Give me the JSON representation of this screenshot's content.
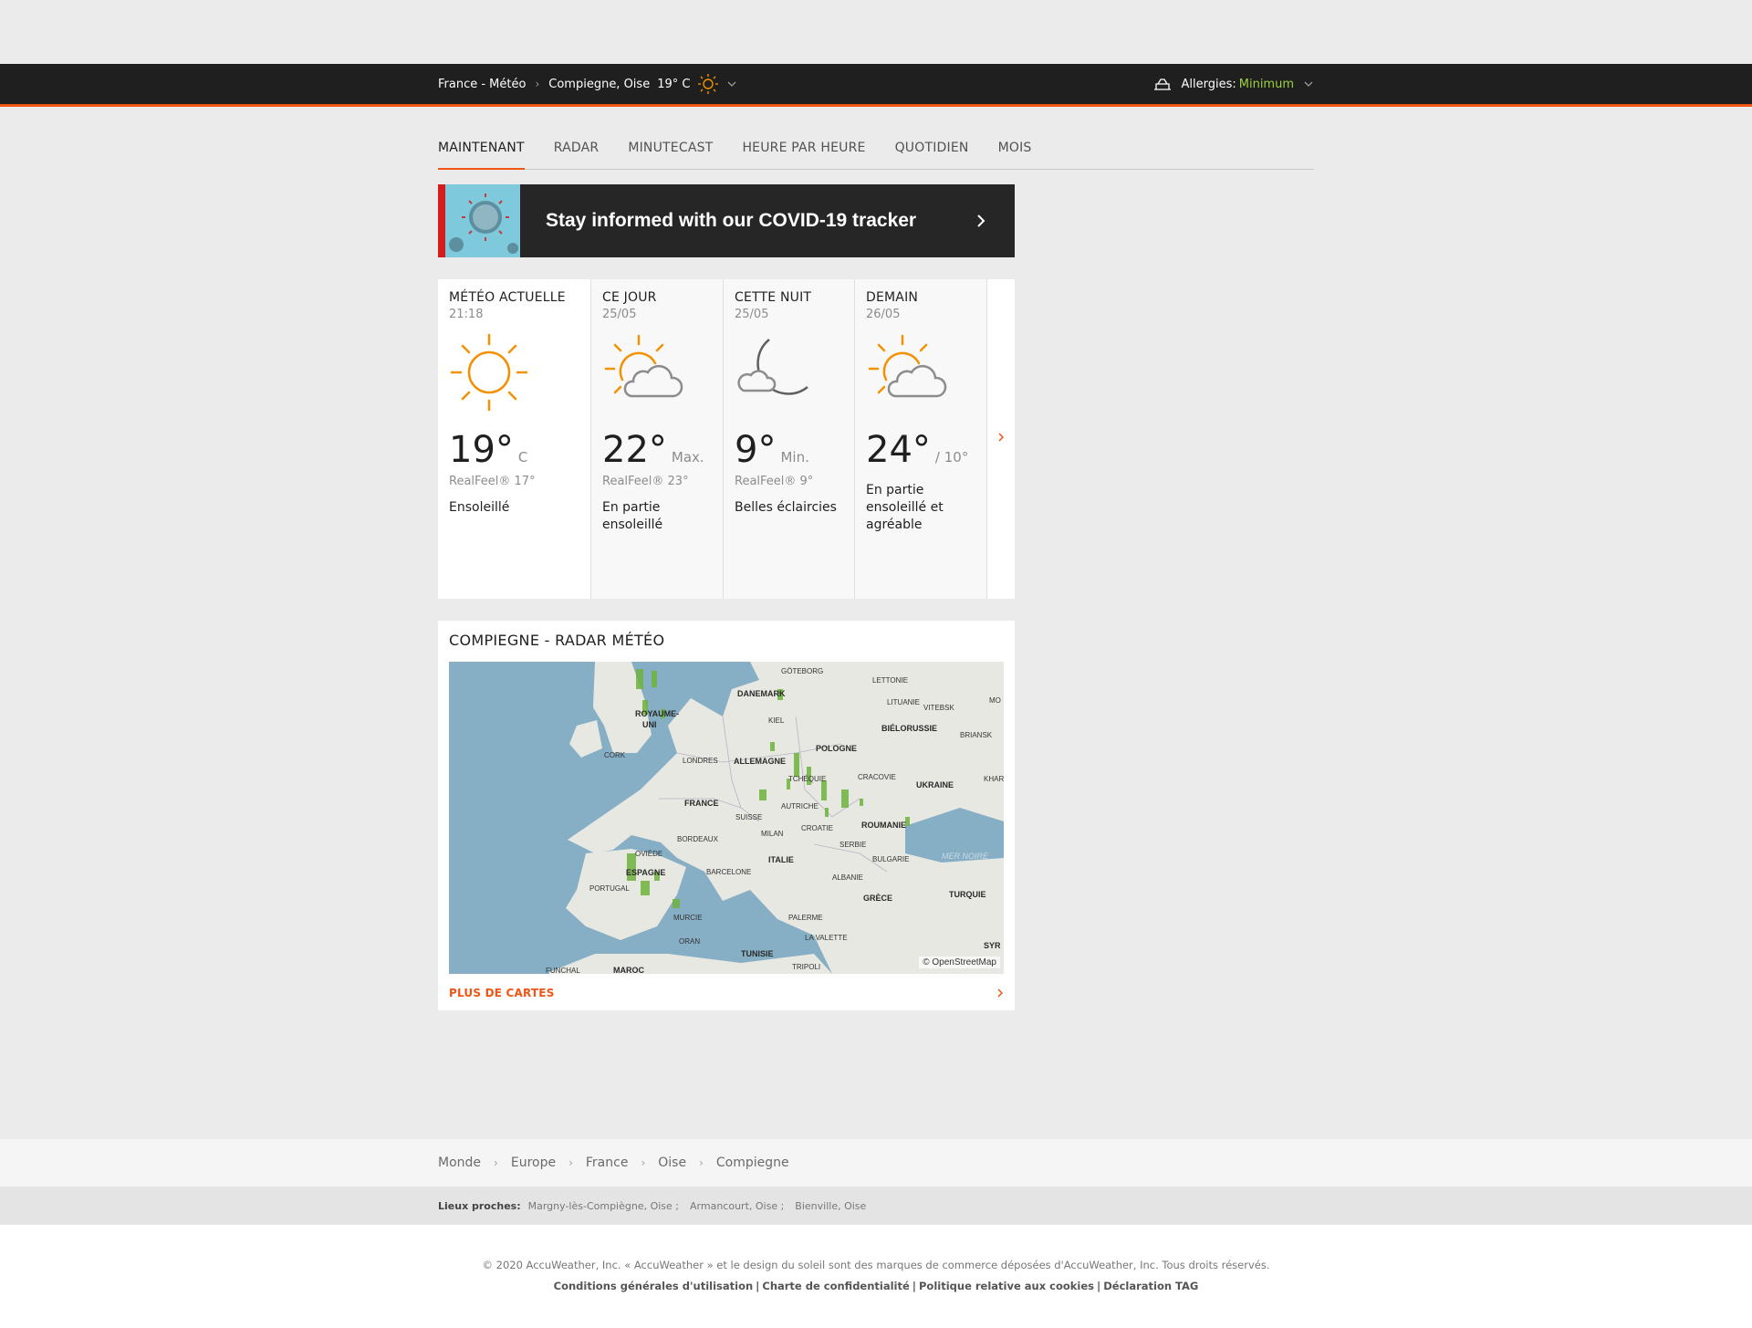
{
  "header": {
    "crumb_country": "France - Météo",
    "crumb_city": "Compiegne, Oise",
    "current_temp": "19° C",
    "allergy_label": "Allergies:",
    "allergy_level": "Minimum"
  },
  "tabs": [
    {
      "label": "MAINTENANT",
      "active": true
    },
    {
      "label": "RADAR",
      "active": false
    },
    {
      "label": "MINUTECAST",
      "active": false
    },
    {
      "label": "HEURE PAR HEURE",
      "active": false
    },
    {
      "label": "QUOTIDIEN",
      "active": false
    },
    {
      "label": "MOIS",
      "active": false
    }
  ],
  "banner": {
    "text": "Stay informed with our COVID-19 tracker"
  },
  "cards": [
    {
      "title": "MÉTÉO ACTUELLE",
      "sub": "21:18",
      "icon": "sun-icon",
      "temp": "19°",
      "unit": "C",
      "realfeel": "RealFeel® 17°",
      "phrase": "Ensoleillé"
    },
    {
      "title": "CE JOUR",
      "sub": "25/05",
      "icon": "partly-sunny-icon",
      "temp": "22°",
      "unit": "Max.",
      "realfeel": "RealFeel® 23°",
      "phrase": "En partie ensoleillé"
    },
    {
      "title": "CETTE NUIT",
      "sub": "25/05",
      "icon": "moon-cloud-icon",
      "temp": "9°",
      "unit": "Min.",
      "realfeel": "RealFeel® 9°",
      "phrase": "Belles éclaircies"
    },
    {
      "title": "DEMAIN",
      "sub": "26/05",
      "icon": "partly-sunny-icon",
      "temp": "24°",
      "unit": "/ 10°",
      "realfeel": "",
      "phrase": "En partie ensoleillé et agréable"
    }
  ],
  "radar": {
    "title": "COMPIEGNE - RADAR MÉTÉO",
    "more": "PLUS DE CARTES",
    "attribution": "© OpenStreetMap",
    "labels": {
      "goteborg": "GÖTEBORG",
      "lettonie": "LETTONIE",
      "danemark": "DANEMARK",
      "lituanie": "LITUANIE",
      "vitebsk": "VITEBSK",
      "royaume": "ROYAUME-",
      "uni": "UNI",
      "kiel": "KIEL",
      "bielorussie": "BIÉLORUSSIE",
      "briansk": "BRIANSK",
      "pologne": "POLOGNE",
      "cork": "CORK",
      "londres": "LONDRES",
      "allemagne": "ALLEMAGNE",
      "cracovie": "CRACOVIE",
      "tcheque": "TCHÉQUIE",
      "ukraine": "UKRAINE",
      "khar": "KHAR",
      "france": "FRANCE",
      "autriche": "AUTRICHE",
      "suisse": "SUISSE",
      "croatie": "CROATIE",
      "roumanie": "ROUMANIE",
      "bordeaux": "BORDEAUX",
      "milan": "MILAN",
      "serbie": "SERBIE",
      "oviede": "OVIÈDE",
      "italie": "ITALIE",
      "bulgarie": "BULGARIE",
      "mernoire": "MER NOIRE",
      "espagne": "ESPAGNE",
      "barcelone": "BARCELONE",
      "albanie": "ALBANIE",
      "portugal": "PORTUGAL",
      "grece": "GRÈCE",
      "turquie": "TURQUIE",
      "murcie": "MURCIE",
      "palerme": "PALERME",
      "oran": "ORAN",
      "lavalette": "LA VALETTE",
      "tunisie": "TUNISIE",
      "maroc": "MAROC",
      "tripoli": "TRIPOLI",
      "funchal": "FUNCHAL",
      "syr": "SYR",
      "mo": "MO"
    }
  },
  "footer": {
    "breadcrumbs": [
      "Monde",
      "Europe",
      "France",
      "Oise",
      "Compiegne"
    ],
    "nearby_label": "Lieux proches:",
    "nearby": [
      "Margny-lès-Compiègne, Oise ;",
      "Armancourt, Oise ;",
      "Bienville, Oise"
    ],
    "copyright": "© 2020 AccuWeather, Inc. « AccuWeather » et le design du soleil sont des marques de commerce déposées d'AccuWeather, Inc. Tous droits réservés.",
    "links": [
      "Conditions générales d'utilisation",
      "Charte de confidentialité",
      "Politique relative aux cookies",
      "Déclaration TAG"
    ]
  },
  "colors": {
    "accent": "#f05514",
    "header_bg": "#1f1f1f",
    "allergy_level": "#9bd23c",
    "sun": "#f39200"
  }
}
